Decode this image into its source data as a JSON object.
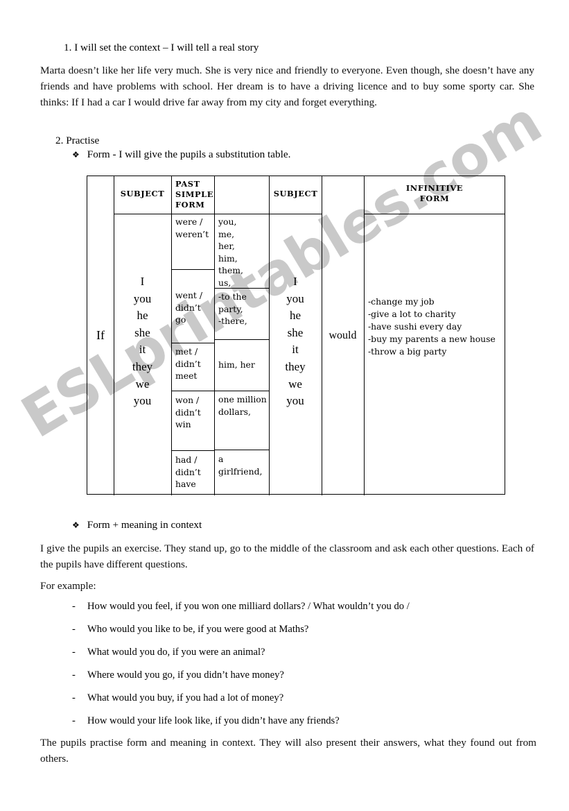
{
  "watermark": {
    "text": "ESLprintables.com"
  },
  "section1": {
    "heading": "1. I will set the context – I will tell a real story",
    "story": "Marta doesn’t like her life very much. She is very nice and friendly to everyone. Even though, she doesn’t have any friends and have problems with school. Her dream is to have a driving licence and to buy some sporty car. She thinks: If I had a car I would drive far away from my city and forget everything."
  },
  "section2": {
    "heading": "2. Practise",
    "bullet1": "Form - I will give the pupils a substitution table.",
    "bullet2": "Form + meaning in context",
    "bullet_glyph": "❖"
  },
  "table": {
    "headers": {
      "col1": "",
      "col2": "SUBJECT",
      "col3": "PAST SIMPLE FORM",
      "col3_lines": [
        "PAST",
        "SIMPLE",
        "FORM"
      ],
      "col4": "",
      "col5": "SUBJECT",
      "col6": "",
      "col7": "INFINITIVE FORM",
      "col7_lines": [
        "INFINITIVE",
        "FORM"
      ]
    },
    "if_cell": "If",
    "subject_pronouns": "I\nyou\nhe\nshe\nit\nthey\nwe\nyou",
    "subject_pronouns_2": "I\nyou\nhe\nshe\nit\nthey\nwe\nyou",
    "would_cell": "would",
    "past_simple_forms": [
      "were / weren’t",
      "went / didn’t go",
      "met / didn’t meet",
      "won / didn’t win",
      "had / didn’t have"
    ],
    "objects": [
      "you,\n me,\nher,\nhim,\nthem,\nus,",
      "-to the party,\n-there,",
      "him, her",
      "one million dollars,",
      "a girlfriend,"
    ],
    "infinitive_forms": "-change my job\n-give a lot to charity\n-have sushi every day\n-buy my parents a new house\n-throw a big party"
  },
  "practice": {
    "intro": "I give the pupils an exercise. They stand up, go to the middle of the classroom and ask each other questions. Each of the pupils have different questions.",
    "for_example": "For example:",
    "dash": "-",
    "questions": [
      "How would you feel, if you won one milliard dollars? / What wouldn’t you do /",
      "Who would you like to be, if you were good at Maths?",
      "What would you do, if you were an animal?",
      "Where would you go, if you didn’t have money?",
      "What would you buy, if you had a lot of money?",
      "How would your life look like, if you didn’t have any friends?"
    ],
    "closing": "The pupils practise form and meaning in context.  They will also present their answers, what they found out from others."
  }
}
